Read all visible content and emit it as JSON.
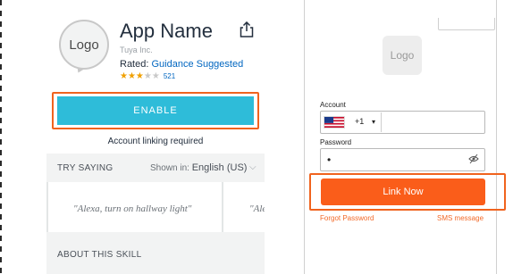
{
  "skill_page": {
    "logo_text": "Logo",
    "app_name": "App Name",
    "developer": "Tuya Inc.",
    "rated_prefix": "Rated: ",
    "rated_value": "Guidance Suggested",
    "rating": {
      "stars_filled": 3,
      "stars_total": 5,
      "filled_glyphs": "★★★",
      "empty_glyphs": "★★",
      "review_count": "521"
    },
    "enable_button_label": "ENABLE",
    "account_linking_note": "Account linking required",
    "try_saying_label": "TRY SAYING",
    "shown_in_label": "Shown in:",
    "language": "English (US)",
    "utterances": [
      "\"Alexa, turn on hallway light\"",
      "\"Ale"
    ],
    "about_label": "ABOUT THIS SKILL"
  },
  "login_page": {
    "logo_text": "Logo",
    "account_label": "Account",
    "country_code": "+1",
    "account_value": "",
    "password_label": "Password",
    "password_mask": "•",
    "link_button_label": "Link Now",
    "forgot_password_label": "Forgot Password",
    "sms_message_label": "SMS message"
  },
  "colors": {
    "enable_button": "#2ebcd9",
    "highlight_outline": "#f0631e",
    "link_button": "#fa5d1a",
    "link_text": "#f26a2a",
    "star": "#f0a000",
    "rated_link": "#0066c0"
  }
}
